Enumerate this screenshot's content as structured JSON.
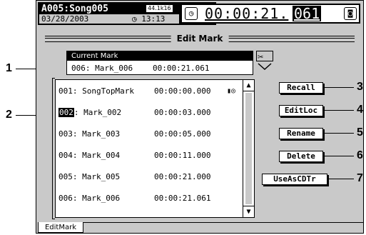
{
  "header": {
    "song": "A005:Song005",
    "rate": "44.1k16",
    "date": "03/28/2003",
    "clock": "◷ 13:13",
    "time": "00:00:21.",
    "frame": "061",
    "time_icon": "clock-icon",
    "lock_icon": "lock-icon"
  },
  "title": "Edit Mark",
  "current_mark": {
    "label": "Current Mark",
    "name": "006: Mark_006",
    "time": "00:00:21.061"
  },
  "marks": [
    {
      "idx": "001",
      "name": ": SongTopMark",
      "time": "00:00:00.000",
      "icon": "▮◎"
    },
    {
      "idx": "002",
      "name": ": Mark_002",
      "time": "00:00:03.000"
    },
    {
      "idx": "003",
      "name": ": Mark_003",
      "time": "00:00:05.000"
    },
    {
      "idx": "004",
      "name": ": Mark_004",
      "time": "00:00:11.000"
    },
    {
      "idx": "005",
      "name": ": Mark_005",
      "time": "00:00:21.000"
    },
    {
      "idx": "006",
      "name": ": Mark_006",
      "time": "00:00:21.061"
    }
  ],
  "buttons": {
    "recall": "Recall",
    "editloc": "EditLoc",
    "rename": "Rename",
    "delete": "Delete",
    "useascdtr": "UseAsCDTr"
  },
  "tab": "EditMark",
  "callouts": [
    "1",
    "2",
    "3",
    "4",
    "5",
    "6",
    "7"
  ]
}
